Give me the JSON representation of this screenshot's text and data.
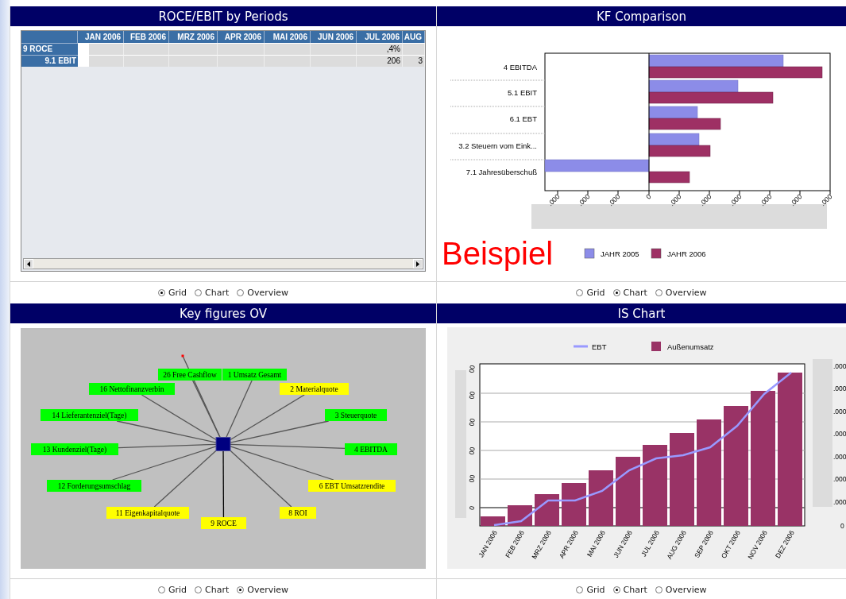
{
  "panels": [
    {
      "title": "ROCE/EBIT by Periods",
      "kind": "grid",
      "columns": [
        "JAN 2006",
        "FEB 2006",
        "MRZ 2006",
        "APR 2006",
        "MAI 2006",
        "JUN 2006",
        "JUL 2006",
        "AUG"
      ],
      "rows": [
        {
          "label": "9 ROCE",
          "cells": [
            null,
            null,
            null,
            null,
            null,
            null,
            ",4%",
            null
          ]
        },
        {
          "label": "9.1 EBIT",
          "cells": [
            null,
            null,
            null,
            null,
            null,
            null,
            "206",
            "3"
          ]
        }
      ],
      "view_options": [
        {
          "label": "Grid",
          "selected": true
        },
        {
          "label": "Chart",
          "selected": false
        },
        {
          "label": "Overview",
          "selected": false
        }
      ]
    },
    {
      "title": "KF Comparison",
      "kind": "bar_compare",
      "categories": [
        "4 EBITDA",
        "5.1 EBIT",
        "6.1 EBT",
        "3.2 Steuern vom Eink...",
        "7.1 Jahresüberschuß"
      ],
      "tick_labels": [
        ".000",
        ".000",
        ".000",
        "0",
        ".000",
        ".000",
        ".000",
        ".000",
        ".000",
        ".000"
      ],
      "example_label": "Beispiel",
      "legend": [
        {
          "label": "JAHR 2005",
          "color": "#8c8ce8"
        },
        {
          "label": "JAHR 2006",
          "color": "#9e3064"
        }
      ],
      "view_options": [
        {
          "label": "Grid",
          "selected": false
        },
        {
          "label": "Chart",
          "selected": true
        },
        {
          "label": "Overview",
          "selected": false
        }
      ]
    },
    {
      "title": "Key figures OV",
      "kind": "diagram",
      "nodes": [
        {
          "label": "26 Free Cashflow",
          "color": "#00ff00"
        },
        {
          "label": "1 Umsatz Gesamt",
          "color": "#00ff00"
        },
        {
          "label": "16 Nettofinanzverbin",
          "color": "#00ff00"
        },
        {
          "label": "2 Materialquote",
          "color": "#ffff00"
        },
        {
          "label": "14 Lieferantenziel(Tage)",
          "color": "#00ff00"
        },
        {
          "label": "3 Steuerquote",
          "color": "#00ff00"
        },
        {
          "label": "13 Kundenziel(Tage)",
          "color": "#00ff00"
        },
        {
          "label": "4 EBITDA",
          "color": "#00ff00"
        },
        {
          "label": "12 Forderungsumschlag",
          "color": "#00ff00"
        },
        {
          "label": "6 EBT Umsatzrendite",
          "color": "#ffff00"
        },
        {
          "label": "11 Eigenkapitalquote",
          "color": "#ffff00"
        },
        {
          "label": "8 ROI",
          "color": "#ffff00"
        },
        {
          "label": "9 ROCE",
          "color": "#ffff00"
        }
      ],
      "view_options": [
        {
          "label": "Grid",
          "selected": false
        },
        {
          "label": "Chart",
          "selected": false
        },
        {
          "label": "Overview",
          "selected": true
        }
      ]
    },
    {
      "title": "IS Chart",
      "kind": "combo",
      "legend": [
        {
          "label": "EBT",
          "color": "#9999ff"
        },
        {
          "label": "Außenumsatz",
          "color": "#993366"
        }
      ],
      "categories": [
        "JAN 2006",
        "FEB 2006",
        "MRZ 2006",
        "APR 2006",
        "MAI 2006",
        "JUN 2006",
        "JUL 2006",
        "AUG 2006",
        "SEP 2006",
        "OKT 2006",
        "NOV 2006",
        "DEZ 2006"
      ],
      "left_tick_labels": [
        "00",
        "00",
        "00",
        "00",
        "00",
        "0"
      ],
      "right_tick_labels": [
        ".000",
        ".000",
        ".000",
        ".000",
        ".000",
        ".000",
        ".000",
        "0"
      ],
      "view_options": [
        {
          "label": "Grid",
          "selected": false
        },
        {
          "label": "Chart",
          "selected": true
        },
        {
          "label": "Overview",
          "selected": false
        }
      ]
    }
  ]
}
